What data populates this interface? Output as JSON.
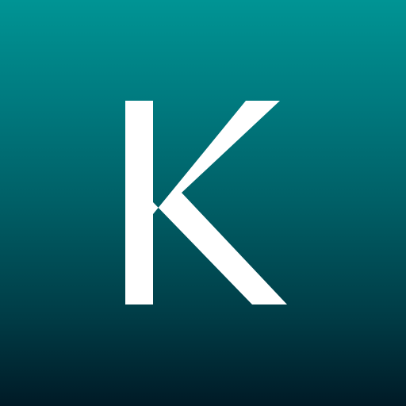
{
  "icon": {
    "letter": "K",
    "letter_color": "#ffffff",
    "gradient_top": "#009494",
    "gradient_bottom": "#001a26"
  }
}
